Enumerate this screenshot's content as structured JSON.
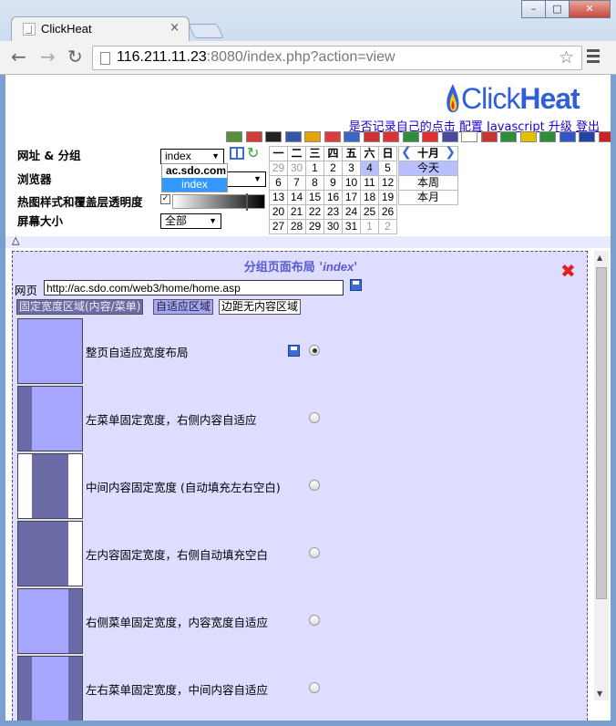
{
  "browser": {
    "tab_title": "ClickHeat",
    "tab_close": "×",
    "url_host": "116.211.11.23",
    "url_rest": ":8080/index.php?action=view",
    "win_min": "–",
    "win_max": "□",
    "win_close": "✕"
  },
  "logo": {
    "part1": "Click",
    "part2": "Heat"
  },
  "toplinks": {
    "record": "是否记录自己的点击",
    "config": "配置",
    "javascript": "Javascript",
    "upgrade": "升级",
    "logout": "登出"
  },
  "flags": [
    "#5a8f3a",
    "#d33b3b",
    "#222222",
    "#3355aa",
    "#e5a500",
    "#e03a3a",
    "#3a66c4",
    "#cc3333",
    "#e03030",
    "#2b8f3a",
    "#e03030",
    "#4a4a9e",
    "#ffffff",
    "#cc3333",
    "#2b8f3a",
    "#e5c000",
    "#2b8f3a",
    "#3355cc",
    "#2244aa",
    "#cc2222",
    "#3366dd",
    "#cc2222"
  ],
  "filters": {
    "site_label": "网址 & 分组",
    "browser_label": "浏览器",
    "heatmap_label": "热图样式和覆盖层透明度",
    "screen_label": "屏幕大小",
    "site_value": "index",
    "screen_value": "全部",
    "dropdown_options": [
      "ac.sdo.com",
      "index"
    ]
  },
  "calendar": {
    "month": "十月",
    "weekdays": [
      "一",
      "二",
      "三",
      "四",
      "五",
      "六",
      "日"
    ],
    "days": [
      [
        "29",
        "30",
        "1",
        "2",
        "3",
        "4",
        "5"
      ],
      [
        "6",
        "7",
        "8",
        "9",
        "10",
        "11",
        "12"
      ],
      [
        "13",
        "14",
        "15",
        "16",
        "17",
        "18",
        "19"
      ],
      [
        "20",
        "21",
        "22",
        "23",
        "24",
        "25",
        "26"
      ],
      [
        "27",
        "28",
        "29",
        "30",
        "31",
        "1",
        "2"
      ]
    ],
    "other_month": [
      [
        0,
        0
      ],
      [
        0,
        1
      ],
      [
        4,
        5
      ],
      [
        4,
        6
      ]
    ],
    "selected_day": [
      0,
      5
    ],
    "ranges": [
      "今天",
      "本周",
      "本月"
    ],
    "active_range": 0
  },
  "panel": {
    "title_prefix": "分组页面布局 '",
    "title_group": "index",
    "title_suffix": "'",
    "url_label": "网页",
    "url_value": "http://ac.sdo.com/web3/home/home.asp",
    "legend_fixed": "固定宽度区域(内容/菜单)",
    "legend_fluid": "自适应区域",
    "legend_margin": "边距无内容区域",
    "layouts": [
      "整页自适应宽度布局",
      "左菜单固定宽度，右侧内容自适应",
      "中间内容固定宽度 (自动填充左右空白)",
      "左内容固定宽度，右侧自动填充空白",
      "右侧菜单固定宽度，内容宽度自适应",
      "左右菜单固定宽度，中间内容自适应"
    ],
    "selected_layout": 0
  },
  "colors": {
    "fixed": "#6b6ba8",
    "fluid": "#a6a6ff",
    "margin": "#ffffff",
    "accent": "#2f5fd8"
  }
}
